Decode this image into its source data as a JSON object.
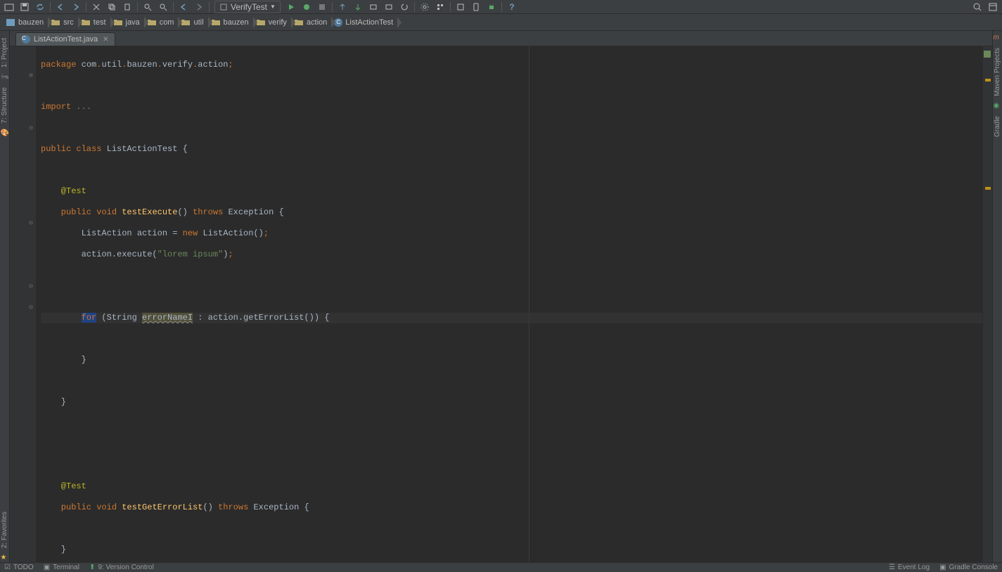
{
  "run_config": "VerifyTest",
  "breadcrumbs": [
    {
      "label": "bauzen",
      "type": "module"
    },
    {
      "label": "src",
      "type": "folder"
    },
    {
      "label": "test",
      "type": "folder"
    },
    {
      "label": "java",
      "type": "folder"
    },
    {
      "label": "com",
      "type": "folder"
    },
    {
      "label": "util",
      "type": "folder"
    },
    {
      "label": "bauzen",
      "type": "folder"
    },
    {
      "label": "verify",
      "type": "folder"
    },
    {
      "label": "action",
      "type": "folder"
    },
    {
      "label": "ListActionTest",
      "type": "class"
    }
  ],
  "tab": {
    "name": "ListActionTest.java"
  },
  "left_tools": {
    "project": "1: Project",
    "structure": "7: Structure",
    "favorites": "2: Favorites"
  },
  "right_tools": {
    "maven": "Maven Projects",
    "gradle": "Gradle"
  },
  "bottom": {
    "todo": "TODO",
    "terminal": "Terminal",
    "vcs": "9: Version Control",
    "eventlog": "Event Log",
    "gradle": "Gradle Console"
  },
  "code": {
    "l1a": "package",
    "l1b": " com",
    "l1c": ".",
    "l1d": "util",
    "l1e": ".",
    "l1f": "bauzen",
    "l1g": ".",
    "l1h": "verify",
    "l1i": ".",
    "l1j": "action",
    "l1k": ";",
    "l3a": "import",
    "l3b": " ...",
    "l5a": "public class",
    "l5b": " ListActionTest {",
    "l7a": "    @Test",
    "l8a": "    public void",
    "l8b": " testExecute",
    "l8c": "() ",
    "l8d": "throws",
    "l8e": " Exception {",
    "l9a": "        ListAction action = ",
    "l9b": "new",
    "l9c": " ListAction()",
    "l9d": ";",
    "l10a": "        action.execute(",
    "l10b": "\"lorem ipsum\"",
    "l10c": ")",
    "l10d": ";",
    "l13a": "        ",
    "l13b": "for",
    "l13c": " (String ",
    "l13d": "errorNameI",
    "l13e": " : action.getErrorList()) {",
    "l15a": "        }",
    "l17a": "    }",
    "l21a": "    @Test",
    "l22a": "    public void",
    "l22b": " testGetErrorList",
    "l22c": "() ",
    "l22d": "throws",
    "l22e": " Exception {",
    "l24a": "    }",
    "l25a": "}"
  }
}
